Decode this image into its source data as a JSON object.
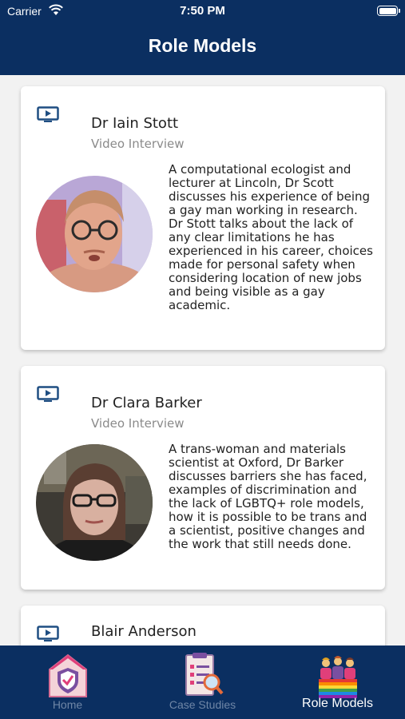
{
  "status_bar": {
    "carrier": "Carrier",
    "time": "7:50 PM"
  },
  "header": {
    "title": "Role Models"
  },
  "cards": [
    {
      "icon": "video-play-icon",
      "name": "Dr Iain Stott",
      "type": "Video Interview",
      "description": "A computational ecologist and lecturer at Lincoln, Dr Scott discusses his experience of being a gay man working in research. Dr Stott talks about the lack of any clear limitations he has experienced in his career, choices made for personal safety when considering location of new jobs and being visible as a gay academic."
    },
    {
      "icon": "video-play-icon",
      "name": "Dr Clara Barker",
      "type": "Video Interview",
      "description": "A trans-woman and materials scientist at Oxford, Dr Barker discusses barriers she has faced, examples of discrimination and the lack of LGBTQ+ role models, how it is possible to be trans and a scientist, positive changes and the work that still needs done."
    },
    {
      "icon": "video-play-icon",
      "name": "Blair Anderson",
      "type": "",
      "description": ""
    }
  ],
  "tabs": [
    {
      "label": "Home",
      "icon": "home-shield-icon",
      "active": false
    },
    {
      "label": "Case Studies",
      "icon": "case-studies-icon",
      "active": false
    },
    {
      "label": "Role Models",
      "icon": "role-models-icon",
      "active": true
    }
  ],
  "colors": {
    "nav": "#0b2f61",
    "inactive_tab": "#6f86a6",
    "icon_blue": "#1f4e82"
  }
}
